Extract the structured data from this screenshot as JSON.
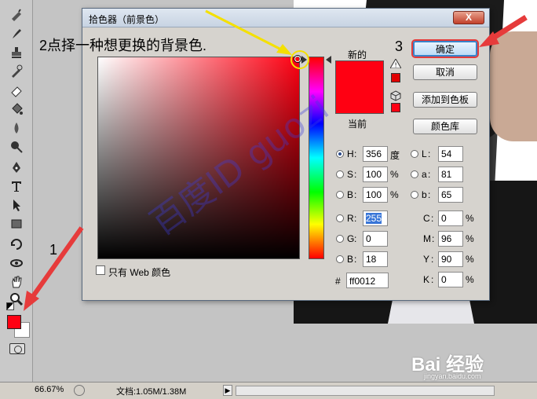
{
  "dialog": {
    "title": "拾色器（前景色）",
    "close_label": "X",
    "new_label": "新的",
    "current_label": "当前",
    "ok_label": "确定",
    "cancel_label": "取消",
    "add_swatch_label": "添加到色板",
    "libraries_label": "颜色库",
    "web_only_label": "只有 Web 颜色",
    "new_color": "#ff0012",
    "fields": {
      "hsb": [
        {
          "key": "H",
          "value": "356",
          "unit": "度",
          "selected": true
        },
        {
          "key": "S",
          "value": "100",
          "unit": "%",
          "selected": false
        },
        {
          "key": "B",
          "value": "100",
          "unit": "%",
          "selected": false
        }
      ],
      "rgb": [
        {
          "key": "R",
          "value": "255"
        },
        {
          "key": "G",
          "value": "0"
        },
        {
          "key": "B",
          "value": "18"
        }
      ],
      "lab": [
        {
          "key": "L",
          "value": "54"
        },
        {
          "key": "a",
          "value": "81"
        },
        {
          "key": "b",
          "value": "65"
        }
      ],
      "cmyk": [
        {
          "key": "C",
          "value": "0",
          "unit": "%"
        },
        {
          "key": "M",
          "value": "96",
          "unit": "%"
        },
        {
          "key": "Y",
          "value": "90",
          "unit": "%"
        },
        {
          "key": "K",
          "value": "0",
          "unit": "%"
        }
      ],
      "hex_label": "#",
      "hex": "ff0012"
    }
  },
  "annotations": {
    "step_1": "1",
    "step_2": "2点择一种想更换的背景色.",
    "step_3": "3"
  },
  "watermark": "百度ID guozi",
  "statusbar": {
    "zoom": "66.67%",
    "doc_info": "文档:1.05M/1.38M"
  },
  "branding": {
    "logo": "Bai 经验",
    "url": "jingyan.baidu.com"
  },
  "toolbar_icons": [
    "healing-brush-icon",
    "brush-icon",
    "stamp-icon",
    "history-brush-icon",
    "eraser-icon",
    "paint-bucket-icon",
    "blur-icon",
    "dodge-icon",
    "pen-icon",
    "type-icon",
    "path-select-icon",
    "shape-icon",
    "3d-rotate-icon",
    "3d-orbit-icon",
    "hand-icon",
    "zoom-icon"
  ],
  "colors": {
    "foreground": "#ff0012",
    "background": "#ffffff",
    "accent_arrow": "#e63b3b",
    "highlight_arrow": "#f4e000"
  }
}
